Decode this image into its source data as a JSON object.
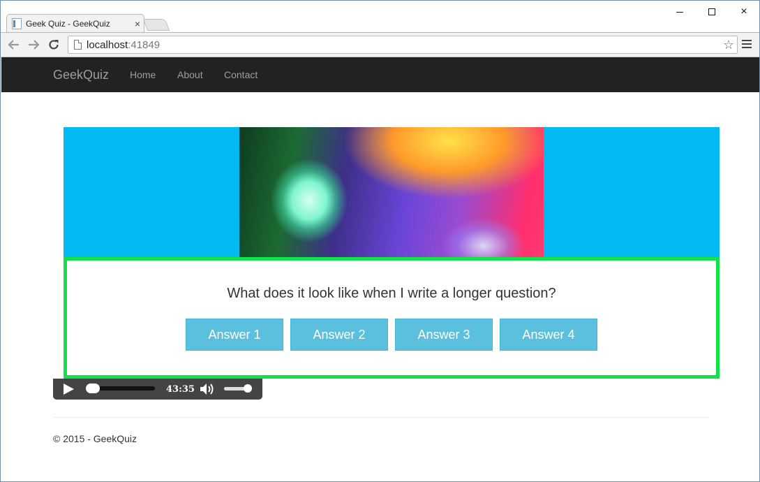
{
  "browser": {
    "tab_title": "Geek Quiz - GeekQuiz",
    "tab_close": "×",
    "url_host": "localhost",
    "url_port": ":41849",
    "window_controls": {
      "minimize": "minimize-icon",
      "maximize": "maximize-icon",
      "close": "×"
    }
  },
  "navbar": {
    "brand": "GeekQuiz",
    "links": [
      "Home",
      "About",
      "Contact"
    ],
    "background": "#222222",
    "link_color": "#9d9d9d"
  },
  "quiz": {
    "hero_background": "#02b9f2",
    "question": "What does it look like when I write a longer question?",
    "answers": [
      "Answer 1",
      "Answer 2",
      "Answer 3",
      "Answer 4"
    ],
    "border_color": "#11e24a",
    "answer_color": "#5bc0de"
  },
  "audio_player": {
    "time": "43:35",
    "progress": 0,
    "volume": 0.85
  },
  "footer": {
    "text": "© 2015 - GeekQuiz"
  }
}
